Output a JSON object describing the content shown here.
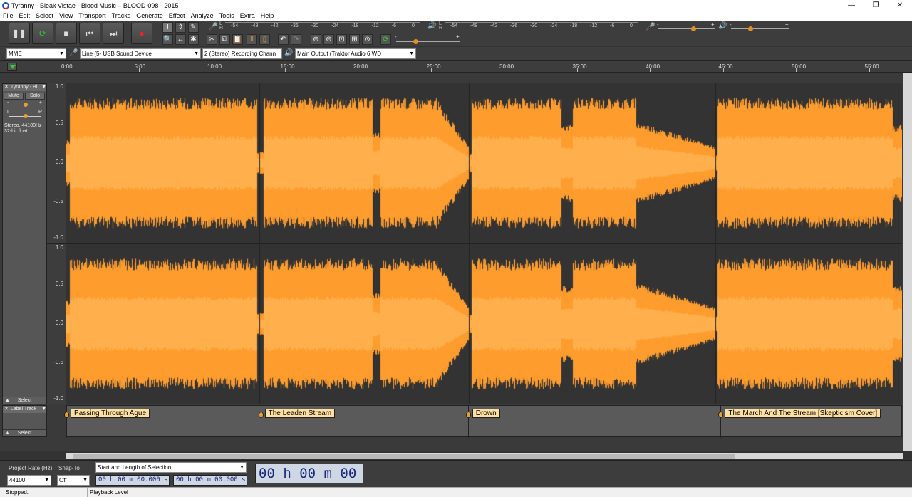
{
  "window": {
    "title": "Tyranny - Bleak Vistae - Blood Music – BLOOD-098 - 2015",
    "minimize": "—",
    "maximize": "❐",
    "close": "✕"
  },
  "menu": [
    "File",
    "Edit",
    "Select",
    "View",
    "Transport",
    "Tracks",
    "Generate",
    "Effect",
    "Analyze",
    "Tools",
    "Extra",
    "Help"
  ],
  "transport": {
    "pause": "❚❚",
    "loop": "⟳",
    "stop": "■",
    "skip_start": "⏮",
    "skip_end": "⏭",
    "record": "●"
  },
  "tools": {
    "selection": "I",
    "envelope": "⇕",
    "draw": "✎",
    "zoom": "🔍",
    "timeshift": "↔",
    "multi": "✱",
    "cut": "✂",
    "copy": "⧉",
    "paste": "📋",
    "trim": "⫴",
    "silence": "▯",
    "undo": "↶",
    "redo": "↷",
    "zoom_in": "⊕",
    "zoom_out": "⊖",
    "fit_sel": "⊡",
    "fit_proj": "⊞",
    "zoom_toggle": "⊙",
    "play_at_speed": "⟳"
  },
  "record_meter": {
    "channels": [
      "L",
      "R"
    ],
    "ticks": [
      "-54",
      "-48",
      "-42",
      "-36",
      "-30",
      "-24",
      "-18",
      "-12",
      "-6",
      "0"
    ]
  },
  "playback_meter": {
    "channels": [
      "L",
      "R"
    ],
    "ticks": [
      "-54",
      "-48",
      "-42",
      "-36",
      "-30",
      "-24",
      "-18",
      "-12",
      "-6",
      "0"
    ]
  },
  "mixer": {
    "minus": "-",
    "plus": "+"
  },
  "devices": {
    "host": "MME",
    "recording_device": "Line (5- USB Sound Device",
    "recording_channels": "2 (Stereo) Recording Chann",
    "playback_device": "Main Output (Traktor Audio 6 WD"
  },
  "timeline": {
    "ticks": [
      "0:00",
      "5:00",
      "10:00",
      "15:00",
      "20:00",
      "25:00",
      "30:00",
      "35:00",
      "40:00",
      "45:00",
      "50:00",
      "55:00"
    ]
  },
  "audio_track": {
    "name": "Tyranny - Bl",
    "mute": "Mute",
    "solo": "Solo",
    "gain_minus": "-",
    "gain_plus": "+",
    "pan_left": "L",
    "pan_right": "R",
    "info_line1": "Stereo, 44100Hz",
    "info_line2": "32-bit float",
    "select": "Select",
    "y_labels": [
      "1.0",
      "0.5",
      "0.0",
      "-0.5",
      "-1.0"
    ],
    "colors": {
      "outer": "#ff9c2e",
      "inner": "#ffb04c",
      "bg": "#333333"
    }
  },
  "label_track": {
    "name": "Label Track",
    "select": "Select",
    "labels": [
      {
        "text": "Passing Through Ague",
        "start_min": 0
      },
      {
        "text": "The Leaden Stream",
        "start_min": 13.3
      },
      {
        "text": "Drown",
        "start_min": 27.5
      },
      {
        "text": "The March And The Stream [Skepticism Cover]",
        "start_min": 44.8
      }
    ]
  },
  "selection_toolbar": {
    "project_rate_label": "Project Rate (Hz)",
    "project_rate": "44100",
    "snap_to_label": "Snap-To",
    "snap_to": "Off",
    "selection_mode": "Start and Length of Selection",
    "start_time": "00 h 00 m 00.000 s",
    "length_time": "00 h 00 m 00.000 s",
    "audio_position": "00 h 00 m 00 s"
  },
  "status": {
    "state": "Stopped.",
    "hint": "Playback Level"
  }
}
